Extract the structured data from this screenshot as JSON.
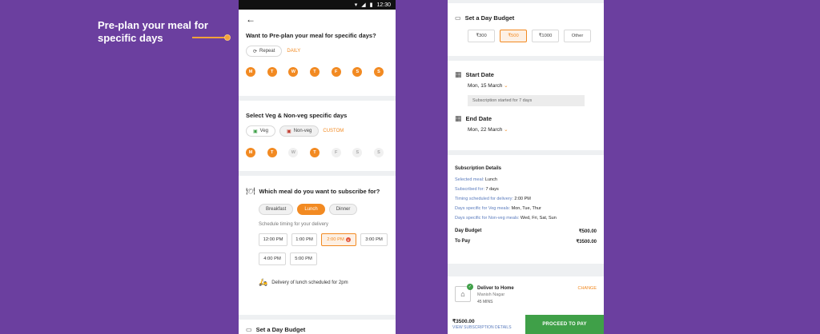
{
  "promo": {
    "headline": "Pre-plan your meal for specific days"
  },
  "status": {
    "time": "12:30"
  },
  "phone1": {
    "preplan": {
      "question": "Want to Pre-plan your meal for specific days?",
      "repeat_label": "Repeat",
      "mode": "DAILY",
      "days": [
        "M",
        "T",
        "W",
        "T",
        "F",
        "S",
        "S"
      ]
    },
    "vegnonveg": {
      "title": "Select Veg & Non-veg specific days",
      "veg_label": "Veg",
      "nonveg_label": "Non-veg",
      "mode": "CUSTOM",
      "days": [
        "M",
        "T",
        "W",
        "T",
        "F",
        "S",
        "S"
      ]
    },
    "meal": {
      "title": "Which meal do you want to subscribe for?",
      "options": [
        "Breakfast",
        "Lunch",
        "Dinner"
      ],
      "schedule_label": "Schedule timing for your delivery",
      "slots": [
        "12:00 PM",
        "1:00 PM",
        "2:00 PM",
        "3:00 PM",
        "4:00 PM",
        "5:00 PM"
      ],
      "delivery_note": "Delivery of lunch scheduled for 2pm"
    },
    "budget_title": "Set a Day Budget"
  },
  "phone2": {
    "budget": {
      "title": "Set a Day Budget",
      "options": [
        "₹300",
        "₹500",
        "₹1000",
        "Other"
      ]
    },
    "start": {
      "label": "Start Date",
      "value": "Mon, 15 March",
      "note": "Subscription started for 7 days"
    },
    "end": {
      "label": "End Date",
      "value": "Mon, 22 March"
    },
    "details": {
      "title": "Subscription Details",
      "rows": [
        {
          "k": "Selected meal:",
          "v": "Lunch"
        },
        {
          "k": "Subscribed for:",
          "v": "7 days"
        },
        {
          "k": "Timing scheduled for delivery:",
          "v": "2:00 PM"
        },
        {
          "k": "Days specific for Veg meals:",
          "v": "Mon, Tue, Thur"
        },
        {
          "k": "Days specific for Non-veg meals:",
          "v": "Wed, Fri, Sat, Sun"
        }
      ],
      "day_budget_label": "Day Budget",
      "day_budget_value": "₹500.00",
      "to_pay_label": "To Pay",
      "to_pay_value": "₹3500.00"
    },
    "deliver": {
      "title": "Deliver to Home",
      "change": "CHANGE",
      "address": "Manish Nagar",
      "eta": "45 MINS"
    },
    "footer": {
      "amount": "₹3500.00",
      "view_link": "VIEW SUBSCRIPTION DETAILS",
      "proceed": "PROCEED TO PAY"
    }
  }
}
